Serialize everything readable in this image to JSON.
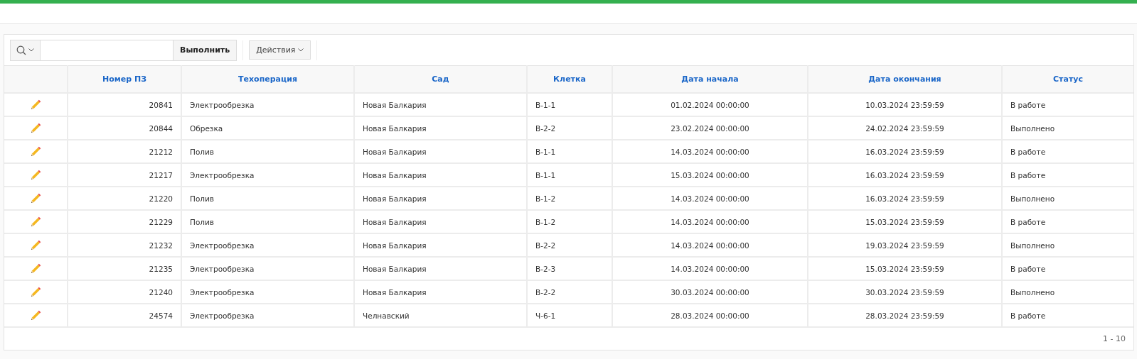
{
  "toolbar": {
    "search_button": "Выполнить",
    "actions_menu": "Действия"
  },
  "table": {
    "columns": [
      "Номер ПЗ",
      "Техоперация",
      "Сад",
      "Клетка",
      "Дата начала",
      "Дата окончания",
      "Статус"
    ],
    "rows": [
      {
        "number": "20841",
        "operation": "Электрообрезка",
        "garden": "Новая Балкария",
        "cell": "В-1-1",
        "start": "01.02.2024 00:00:00",
        "end": "10.03.2024 23:59:59",
        "status": "В работе"
      },
      {
        "number": "20844",
        "operation": "Обрезка",
        "garden": "Новая Балкария",
        "cell": "В-2-2",
        "start": "23.02.2024 00:00:00",
        "end": "24.02.2024 23:59:59",
        "status": "Выполнено"
      },
      {
        "number": "21212",
        "operation": "Полив",
        "garden": "Новая Балкария",
        "cell": "В-1-1",
        "start": "14.03.2024 00:00:00",
        "end": "16.03.2024 23:59:59",
        "status": "В работе"
      },
      {
        "number": "21217",
        "operation": "Электрообрезка",
        "garden": "Новая Балкария",
        "cell": "В-1-1",
        "start": "15.03.2024 00:00:00",
        "end": "16.03.2024 23:59:59",
        "status": "В работе"
      },
      {
        "number": "21220",
        "operation": "Полив",
        "garden": "Новая Балкария",
        "cell": "В-1-2",
        "start": "14.03.2024 00:00:00",
        "end": "16.03.2024 23:59:59",
        "status": "Выполнено"
      },
      {
        "number": "21229",
        "operation": "Полив",
        "garden": "Новая Балкария",
        "cell": "В-1-2",
        "start": "14.03.2024 00:00:00",
        "end": "15.03.2024 23:59:59",
        "status": "В работе"
      },
      {
        "number": "21232",
        "operation": "Электрообрезка",
        "garden": "Новая Балкария",
        "cell": "В-2-2",
        "start": "14.03.2024 00:00:00",
        "end": "19.03.2024 23:59:59",
        "status": "Выполнено"
      },
      {
        "number": "21235",
        "operation": "Электрообрезка",
        "garden": "Новая Балкария",
        "cell": "В-2-3",
        "start": "14.03.2024 00:00:00",
        "end": "15.03.2024 23:59:59",
        "status": "В работе"
      },
      {
        "number": "21240",
        "operation": "Электрообрезка",
        "garden": "Новая Балкария",
        "cell": "В-2-2",
        "start": "30.03.2024 00:00:00",
        "end": "30.03.2024 23:59:59",
        "status": "Выполнено"
      },
      {
        "number": "24574",
        "operation": "Электрообрезка",
        "garden": "Челнавский",
        "cell": "Ч-6-1",
        "start": "28.03.2024 00:00:00",
        "end": "28.03.2024 23:59:59",
        "status": "В работе"
      }
    ]
  },
  "pagination": "1 - 10"
}
